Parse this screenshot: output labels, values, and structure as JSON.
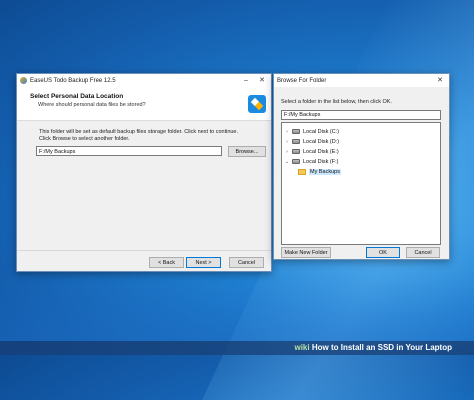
{
  "setup_dialog": {
    "title": "EaseUS Todo Backup Free 12.5",
    "header_title": "Select Personal Data Location",
    "header_subtitle": "Where should personal data files be stored?",
    "info_line1": "This folder will be set as default backup files storage folder. Click next to continue.",
    "info_line2": "Click Browse to select another folder.",
    "path_value": "F:/My Backups",
    "browse_label": "Browse...",
    "back_label": "< Back",
    "next_label": "Next >",
    "cancel_label": "Cancel"
  },
  "browse_dialog": {
    "title": "Browse For Folder",
    "instruction": "Select a folder in the list below, then click OK.",
    "path_value": "F:/My Backups",
    "tree": [
      {
        "label": "Local Disk (C:)",
        "expanded": false
      },
      {
        "label": "Local Disk (D:)",
        "expanded": false
      },
      {
        "label": "Local Disk (E:)",
        "expanded": false
      },
      {
        "label": "Local Disk (F:)",
        "expanded": true
      },
      {
        "label": "My Backups",
        "selected": true
      }
    ],
    "new_folder_label": "Make New Folder",
    "ok_label": "OK",
    "cancel_label": "Cancel"
  },
  "caption": {
    "brand": "wiki",
    "text": "How to Install an SSD in Your Laptop"
  },
  "colors": {
    "accent": "#0078d7",
    "desktop": "#1f7fd0",
    "folder": "#f6c95a"
  }
}
